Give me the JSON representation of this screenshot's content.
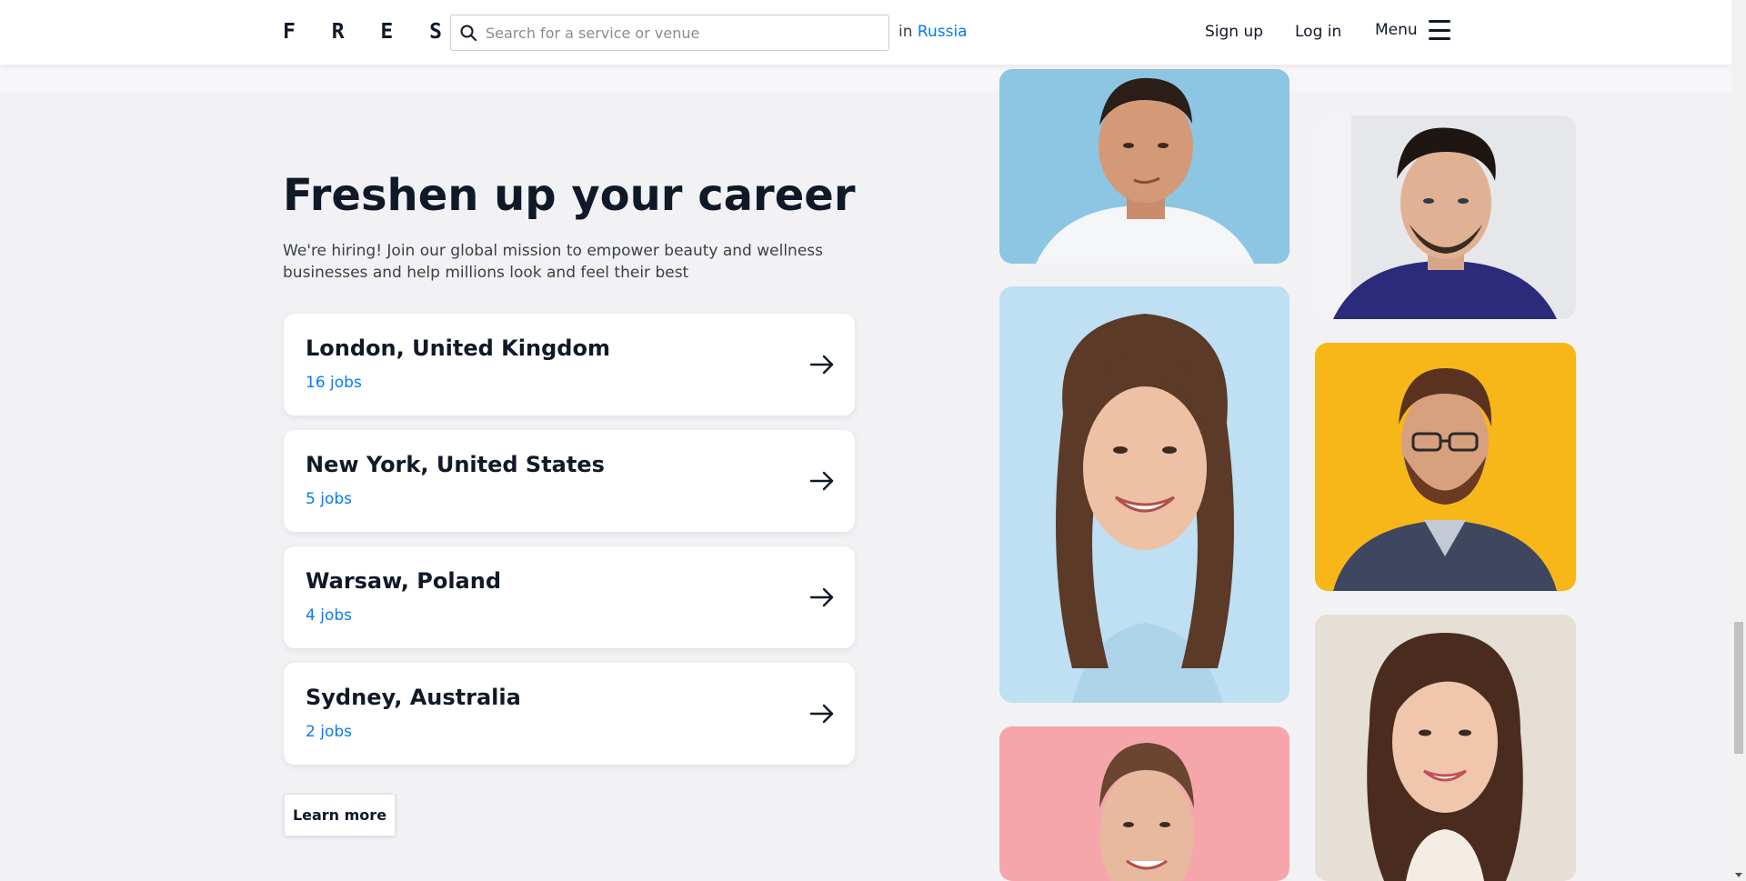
{
  "header": {
    "logo": "F R E S H A",
    "search_placeholder": "Search for a service or venue",
    "location_prefix": "in",
    "location_value": "Russia",
    "signup_label": "Sign up",
    "login_label": "Log in",
    "menu_label": "Menu"
  },
  "careers": {
    "title": "Freshen up your career",
    "subtitle": "We're hiring! Join our global mission to empower beauty and wellness businesses and help millions look and feel their best",
    "jobs": [
      {
        "city": "London, United Kingdom",
        "count": "16 jobs"
      },
      {
        "city": "New York, United States",
        "count": "5 jobs"
      },
      {
        "city": "Warsaw, Poland",
        "count": "4 jobs"
      },
      {
        "city": "Sydney, Australia",
        "count": "2 jobs"
      }
    ],
    "learn_more_label": "Learn more"
  },
  "photos": [
    {
      "name": "man-white-shirt-photo",
      "background": "#8cc6e3"
    },
    {
      "name": "man-purple-shirt-photo",
      "background": "#e6e7ea"
    },
    {
      "name": "smiling-woman-photo",
      "background": "#bfdff3"
    },
    {
      "name": "bearded-man-glasses-photo",
      "background": "#f7b718"
    },
    {
      "name": "woman-pink-background-photo",
      "background": "#f6a6ab"
    },
    {
      "name": "woman-long-hair-photo",
      "background": "#e6dfd6"
    }
  ],
  "colors": {
    "accent": "#037aff",
    "text": "#101928",
    "page_background": "#f2f2f5"
  }
}
